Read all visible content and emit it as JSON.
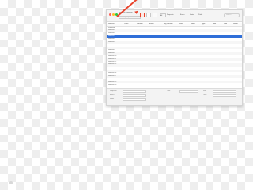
{
  "window": {
    "title": "Requests Summary",
    "subtitle": "Summary report",
    "traffic_lights": [
      "#ff5f57",
      "#febc2e",
      "#28c840"
    ],
    "highlight_color": "#e8442c",
    "selection_color": "#2f6ed8"
  },
  "toolbar": {
    "buttons": [
      "export-icon",
      "refresh-icon",
      "columns-icon"
    ],
    "active_button": "export-icon",
    "segments": [
      "All",
      "Requests",
      "Errors",
      "Hosts",
      "Paths"
    ],
    "search_placeholder": "Search"
  },
  "table": {
    "columns": [
      "Request",
      "Count",
      "Duration",
      "Errors",
      "Avg Duration",
      "Size",
      "Status",
      "Type",
      "Host",
      "Path",
      "Result"
    ],
    "rows": [
      [
        "Summary",
        "",
        "",
        "",
        "",
        "",
        "",
        "",
        "",
        "",
        ""
      ],
      [
        "Request 1",
        "",
        "",
        "",
        "",
        "",
        "",
        "",
        "",
        "",
        ""
      ],
      [
        "Request 2",
        "",
        "",
        "",
        "",
        "",
        "",
        "",
        "",
        "",
        ""
      ],
      [
        "Request 3",
        "",
        "",
        "",
        "",
        "",
        "",
        "",
        "",
        "",
        ""
      ],
      [
        "Request 4",
        "",
        "",
        "",
        "",
        "",
        "",
        "",
        "",
        "",
        ""
      ],
      [
        "Request 5",
        "",
        "",
        "",
        "",
        "",
        "",
        "",
        "",
        "",
        ""
      ],
      [
        "Request 6",
        "",
        "",
        "",
        "",
        "",
        "",
        "",
        "",
        "",
        ""
      ],
      [
        "Request 7",
        "",
        "",
        "",
        "",
        "",
        "",
        "",
        "",
        "",
        ""
      ],
      [
        "Request 8",
        "",
        "",
        "",
        "",
        "",
        "",
        "",
        "",
        "",
        ""
      ],
      [
        "Request 9",
        "",
        "",
        "",
        "",
        "",
        "",
        "",
        "",
        "",
        ""
      ],
      [
        "Request 10",
        "",
        "",
        "",
        "",
        "",
        "",
        "",
        "",
        "",
        ""
      ],
      [
        "Request 11",
        "",
        "",
        "",
        "",
        "",
        "",
        "",
        "",
        "",
        ""
      ],
      [
        "Request 12",
        "",
        "",
        "",
        "",
        "",
        "",
        "",
        "",
        "",
        ""
      ],
      [
        "Request 13",
        "",
        "",
        "",
        "",
        "",
        "",
        "",
        "",
        "",
        ""
      ],
      [
        "Request 14",
        "",
        "",
        "",
        "",
        "",
        "",
        "",
        "",
        "",
        ""
      ],
      [
        "Request 15",
        "",
        "",
        "",
        "",
        "",
        "",
        "",
        "",
        "",
        ""
      ],
      [
        "Request 16",
        "",
        "",
        "",
        "",
        "",
        "",
        "",
        "",
        "",
        ""
      ],
      [
        "Request 17",
        "",
        "",
        "",
        "",
        "",
        "",
        "",
        "",
        "",
        ""
      ],
      [
        "Request 18",
        "",
        "",
        "",
        "",
        "",
        "",
        "",
        "",
        "",
        ""
      ],
      [
        "Request 19",
        "",
        "",
        "",
        "",
        "",
        "",
        "",
        "",
        "",
        ""
      ],
      [
        "Request 20",
        "",
        "",
        "",
        "",
        "",
        "",
        "",
        "",
        "",
        ""
      ]
    ],
    "selected_row": 3
  },
  "status": {
    "labels": [
      "Requests",
      "Errors",
      "Hosts",
      "Total",
      "Size",
      "Time"
    ]
  }
}
